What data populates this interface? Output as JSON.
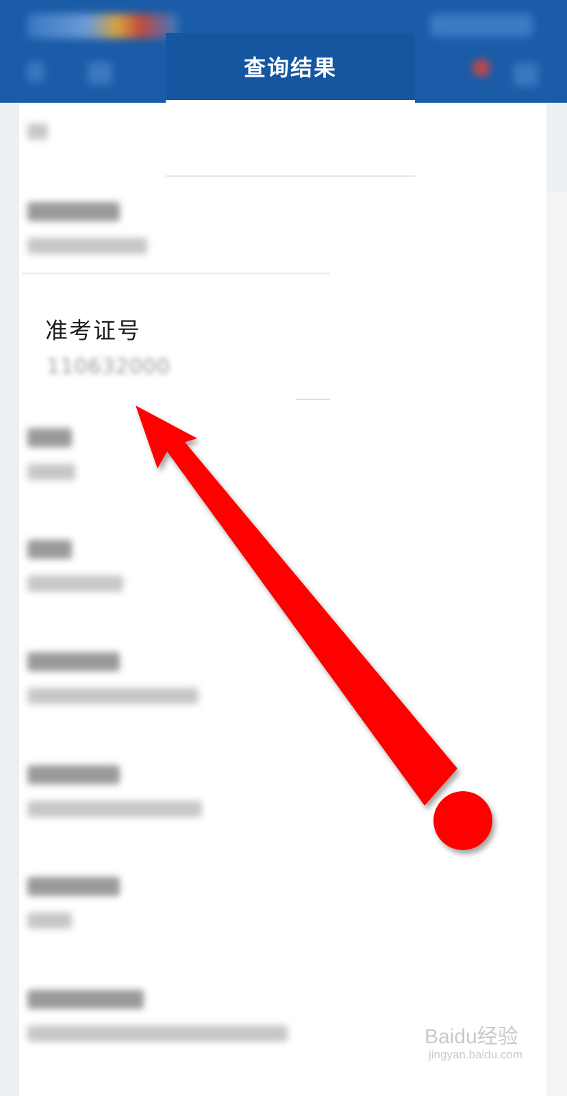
{
  "modal": {
    "title": "查询结果"
  },
  "field": {
    "label": "准考证号",
    "value": "110632000"
  },
  "colors": {
    "header_blue": "#1a5ca8",
    "title_bar_blue": "#1457a0",
    "arrow_red": "#ff0000"
  },
  "watermark": {
    "brand": "Baidu经验",
    "sub": "jingyan.baidu.com"
  }
}
